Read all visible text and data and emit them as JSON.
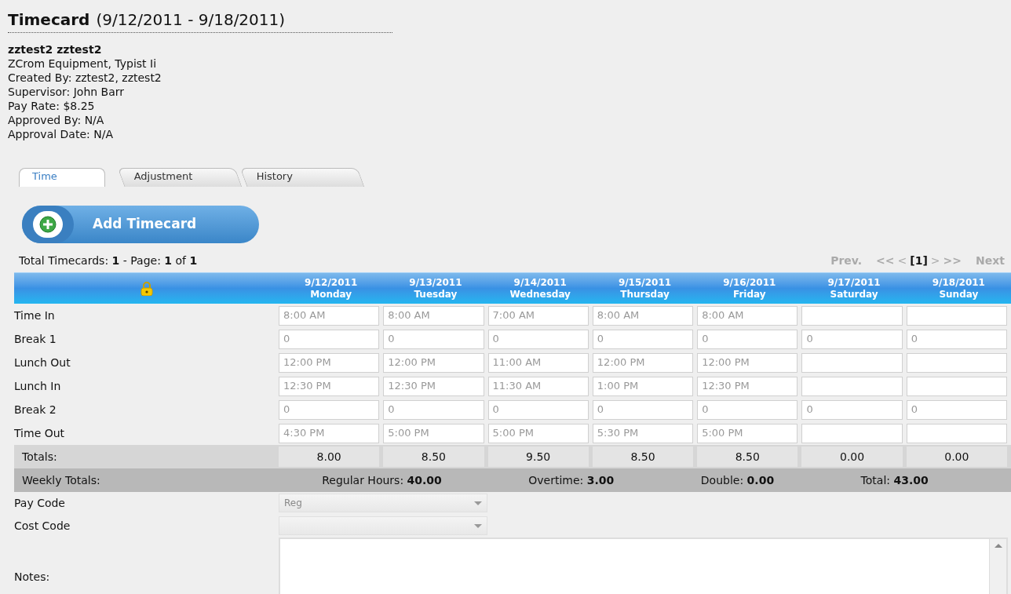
{
  "title": {
    "main": "Timecard",
    "range": "(9/12/2011 - 9/18/2011)"
  },
  "employee": {
    "name": "zztest2 zztest2",
    "lines": [
      "ZCrom Equipment, Typist Ii",
      "Created By: zztest2, zztest2",
      "Supervisor: John Barr",
      "Pay Rate: $8.25",
      "Approved By: N/A",
      "Approval Date: N/A"
    ]
  },
  "tabs": [
    {
      "label": "Time",
      "selected": true
    },
    {
      "label": "Adjustment",
      "selected": false
    },
    {
      "label": "History",
      "selected": false
    }
  ],
  "add_button": {
    "label": "Add Timecard"
  },
  "summary": "Total Timecards: **1** - Page: **1** of **1**",
  "pager": [
    {
      "label": "Prev.",
      "selected": false
    },
    {
      "label": "<<",
      "selected": false
    },
    {
      "label": "<",
      "selected": false
    },
    {
      "label": "[1]",
      "selected": true
    },
    {
      "label": ">",
      "selected": false
    },
    {
      "label": ">>",
      "selected": false
    },
    {
      "label": "Next",
      "selected": false
    }
  ],
  "days": [
    {
      "date": "9/12/2011",
      "day": "Monday"
    },
    {
      "date": "9/13/2011",
      "day": "Tuesday"
    },
    {
      "date": "9/14/2011",
      "day": "Wednesday"
    },
    {
      "date": "9/15/2011",
      "day": "Thursday"
    },
    {
      "date": "9/16/2011",
      "day": "Friday"
    },
    {
      "date": "9/17/2011",
      "day": "Saturday"
    },
    {
      "date": "9/18/2011",
      "day": "Sunday"
    }
  ],
  "rows": [
    {
      "label": "Time In",
      "cells": [
        {
          "value": "8:00 AM"
        },
        {
          "value": "8:00 AM"
        },
        {
          "value": "7:00 AM"
        },
        {
          "value": "8:00 AM"
        },
        {
          "value": "8:00 AM"
        },
        {},
        {}
      ]
    },
    {
      "label": "Break 1",
      "cells": [
        {
          "value": "0"
        },
        {
          "value": "0"
        },
        {
          "value": "0"
        },
        {
          "value": "0"
        },
        {
          "value": "0"
        },
        {
          "value": "0"
        },
        {
          "value": "0"
        }
      ]
    },
    {
      "label": "Lunch Out",
      "cells": [
        {
          "value": "12:00 PM"
        },
        {
          "value": "12:00 PM"
        },
        {
          "value": "11:00 AM"
        },
        {
          "value": "12:00 PM"
        },
        {
          "value": "12:00 PM"
        },
        {},
        {}
      ]
    },
    {
      "label": "Lunch In",
      "cells": [
        {
          "value": "12:30 PM"
        },
        {
          "value": "12:30 PM"
        },
        {
          "value": "11:30 AM"
        },
        {
          "value": "1:00 PM"
        },
        {
          "value": "12:30 PM"
        },
        {},
        {}
      ]
    },
    {
      "label": "Break 2",
      "cells": [
        {
          "value": "0"
        },
        {
          "value": "0"
        },
        {
          "value": "0"
        },
        {
          "value": "0"
        },
        {
          "value": "0"
        },
        {
          "value": "0"
        },
        {
          "value": "0"
        }
      ]
    },
    {
      "label": "Time Out",
      "cells": [
        {
          "value": "4:30 PM"
        },
        {
          "value": "5:00 PM"
        },
        {
          "value": "5:00 PM"
        },
        {
          "value": "5:30 PM"
        },
        {
          "value": "5:00 PM"
        },
        {},
        {}
      ]
    }
  ],
  "totals": {
    "label": "Totals:",
    "values": [
      "8.00",
      "8.50",
      "9.50",
      "8.50",
      "8.50",
      "0.00",
      "0.00"
    ]
  },
  "weekly_totals": {
    "label": "Weekly Totals:",
    "items": [
      {
        "label": "Regular Hours:",
        "value": "40.00"
      },
      {
        "label": "Overtime:",
        "value": "3.00"
      },
      {
        "label": "Double:",
        "value": "0.00"
      },
      {
        "label": "Total:",
        "value": "43.00"
      }
    ]
  },
  "pay_code": {
    "label": "Pay Code",
    "value": "Reg"
  },
  "cost_code": {
    "label": "Cost Code"
  },
  "notes": {
    "label": "Notes:"
  }
}
